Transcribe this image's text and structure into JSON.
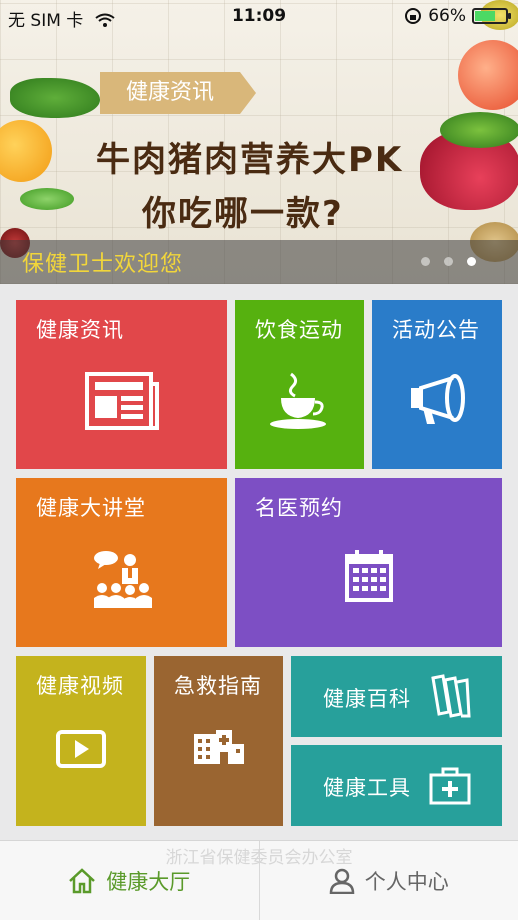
{
  "status_bar": {
    "carrier": "无 SIM 卡",
    "time": "11:09",
    "battery": "66%"
  },
  "banner": {
    "tag": "健康资讯",
    "headline": "牛肉猪肉营养大PK",
    "subline": "你吃哪一款?",
    "caption": "保健卫士欢迎您",
    "page_count": 3,
    "active_page": 3
  },
  "tiles": [
    {
      "id": "health-news",
      "label": "健康资讯",
      "color": "#e1474a",
      "icon": "newspaper-icon"
    },
    {
      "id": "diet-exercise",
      "label": "饮食运动",
      "color": "#56b10f",
      "icon": "coffee-cup-icon"
    },
    {
      "id": "activity-notice",
      "label": "活动公告",
      "color": "#2a7cc9",
      "icon": "megaphone-icon"
    },
    {
      "id": "health-lecture",
      "label": "健康大讲堂",
      "color": "#e7781d",
      "icon": "lecture-icon"
    },
    {
      "id": "doctor-appointment",
      "label": "名医预约",
      "color": "#7d4fc4",
      "icon": "calendar-icon"
    },
    {
      "id": "health-video",
      "label": "健康视频",
      "color": "#c4b31d",
      "icon": "play-icon"
    },
    {
      "id": "first-aid",
      "label": "急救指南",
      "color": "#9a6531",
      "icon": "hospital-icon"
    },
    {
      "id": "health-encyclopedia",
      "label": "健康百科",
      "color": "#27a09b",
      "icon": "books-icon"
    },
    {
      "id": "health-tools",
      "label": "健康工具",
      "color": "#27a09b",
      "icon": "first-aid-kit-icon"
    }
  ],
  "footer_note": "浙江省保健委员会办公室",
  "tabbar": {
    "items": [
      {
        "label": "健康大厅",
        "icon": "home-icon",
        "active": true
      },
      {
        "label": "个人中心",
        "icon": "person-icon",
        "active": false
      }
    ]
  }
}
